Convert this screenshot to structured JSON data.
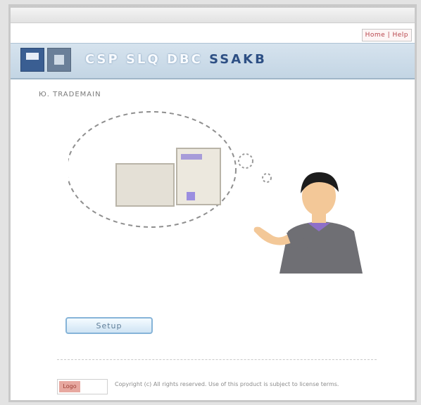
{
  "header": {
    "product_title": "CSP SLQ DBC",
    "product_title_accent": "SSAKB"
  },
  "help_link": "Home | Help",
  "main": {
    "subtitle": "Ю. TRADEMAIN",
    "setup_button_label": "Setup",
    "footer_badge": "Logo",
    "footer_text": "Copyright (c) All rights reserved. Use of this product is subject to license terms."
  }
}
